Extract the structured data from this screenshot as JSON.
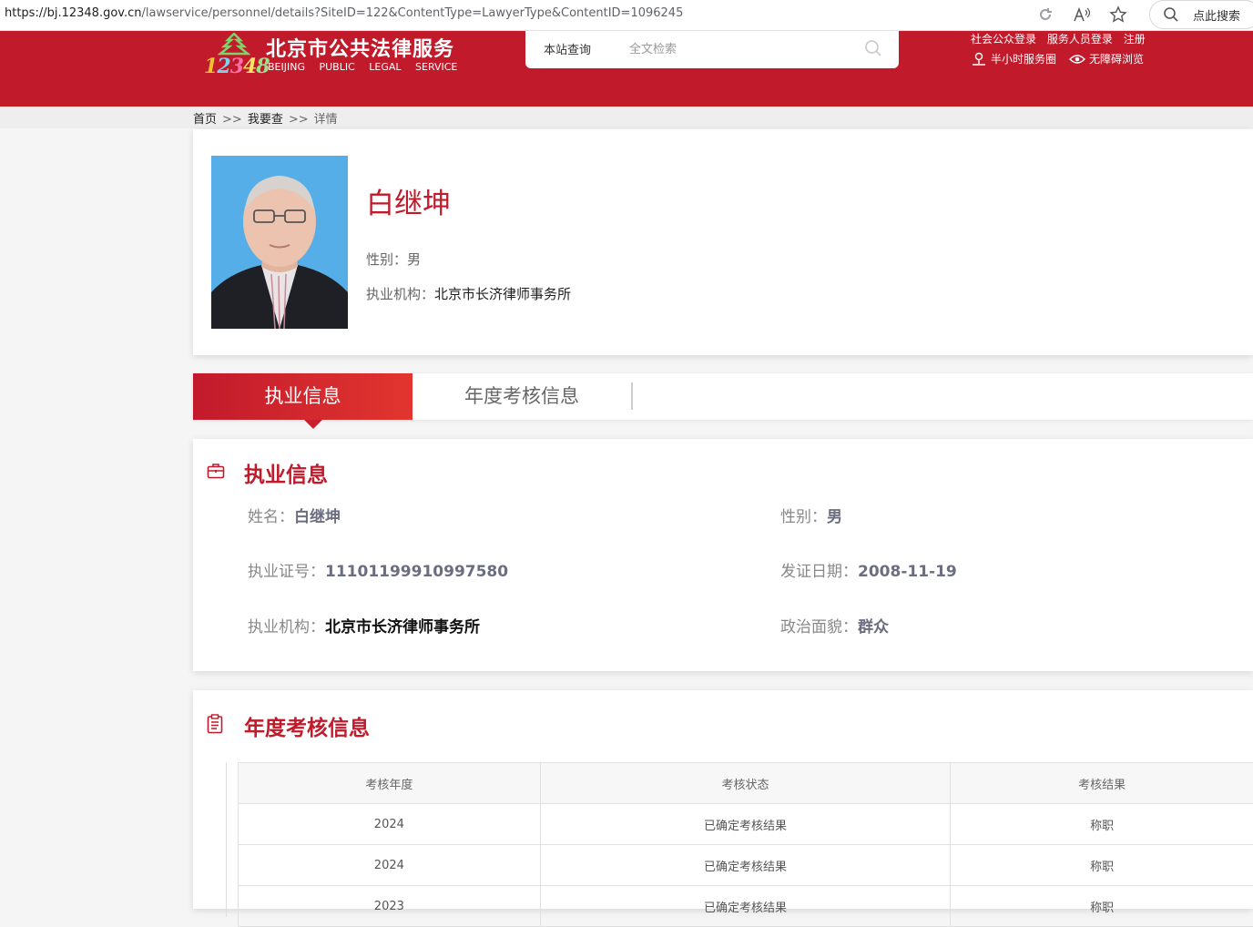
{
  "browser": {
    "url_host": "https://bj.12348.gov.cn",
    "url_path": "/lawservice/personnel/details?SiteID=122&ContentType=LawyerType&ContentID=1096245",
    "search_label": "点此搜索"
  },
  "header": {
    "logo_numbers": [
      "1",
      "2",
      "3",
      "4",
      "8"
    ],
    "logo_cn": "北京市公共法律服务",
    "logo_en": "BEIJING PUBLIC LEGAL SERVICE",
    "search_tab": "本站查询",
    "search_placeholder": "全文检索",
    "links_top": [
      "社会公众登录",
      "服务人员登录",
      "注册"
    ],
    "link_service": "半小时服务圈",
    "link_accessible": "无障碍浏览",
    "accent_color": "#c01a2b"
  },
  "breadcrumb": {
    "home": "首页",
    "sep": ">>",
    "level2": "我要查",
    "current": "详情"
  },
  "profile": {
    "name": "白继坤",
    "gender_line": "性别：男",
    "org_label": "执业机构：",
    "org_value": "北京市长济律师事务所"
  },
  "tabs": {
    "active": "执业信息",
    "second": "年度考核信息"
  },
  "practice": {
    "title": "执业信息",
    "name_label": "姓名：",
    "name_value": "白继坤",
    "gender_label": "性别：",
    "gender_value": "男",
    "cert_label": "执业证号：",
    "cert_value": "11101199910997580",
    "issue_label": "发证日期：",
    "issue_value": "2008-11-19",
    "org_label": "执业机构：",
    "org_value": "北京市长济律师事务所",
    "party_label": "政治面貌：",
    "party_value": "群众"
  },
  "annual": {
    "title": "年度考核信息",
    "headers": [
      "考核年度",
      "考核状态",
      "考核结果"
    ],
    "rows": [
      [
        "2024",
        "已确定考核结果",
        "称职"
      ],
      [
        "2024",
        "已确定考核结果",
        "称职"
      ],
      [
        "2023",
        "已确定考核结果",
        "称职"
      ]
    ]
  }
}
